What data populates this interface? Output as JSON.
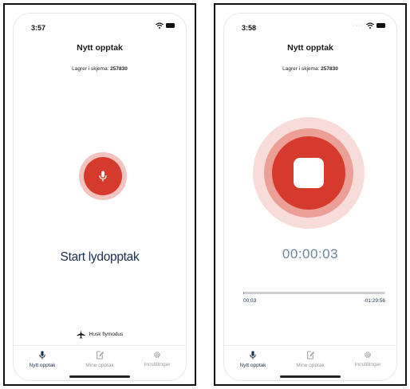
{
  "screens": [
    {
      "status_time": "3:57",
      "title": "Nytt opptak",
      "form_prefix": "Lagrer i skjema: ",
      "form_number": "257830",
      "start_label": "Start lydopptak",
      "flight_mode_hint": "Husk flymodus",
      "tabs": [
        {
          "label": "Nytt opptak",
          "icon": "mic-icon",
          "active": true
        },
        {
          "label": "Mine opptak",
          "icon": "edit-document-icon",
          "active": false
        },
        {
          "label": "Innstillinger",
          "icon": "gear-icon",
          "active": false
        }
      ]
    },
    {
      "status_time": "3:58",
      "title": "Nytt opptak",
      "form_prefix": "Lagrer i skjema: ",
      "form_number": "257830",
      "timer": "00:00:03",
      "elapsed": "00:03",
      "remaining": "-01:29:56",
      "progress_fraction": 0.0006,
      "tabs": [
        {
          "label": "Nytt opptak",
          "icon": "mic-icon",
          "active": true
        },
        {
          "label": "Mine opptak",
          "icon": "edit-document-icon",
          "active": false
        },
        {
          "label": "Innstillinger",
          "icon": "gear-icon",
          "active": false
        }
      ]
    }
  ],
  "colors": {
    "record_red": "#d63a2c",
    "record_ring": "#f2c3bf",
    "navy": "#1a2f4d",
    "timer_blue": "#6d86a0"
  }
}
